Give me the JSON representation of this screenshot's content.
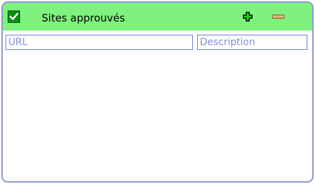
{
  "panel": {
    "title": "Sites approuvés",
    "enabled": true,
    "icons": {
      "checkbox": "checkbox-checked-icon",
      "add": "green-plus-icon",
      "remove": "remove-minus-icon"
    },
    "colors": {
      "header_bg": "#7ef27d",
      "border": "#8d93d6",
      "column_text": "#7f8fd9"
    }
  },
  "table": {
    "columns": [
      "URL",
      "Description"
    ],
    "rows": []
  }
}
